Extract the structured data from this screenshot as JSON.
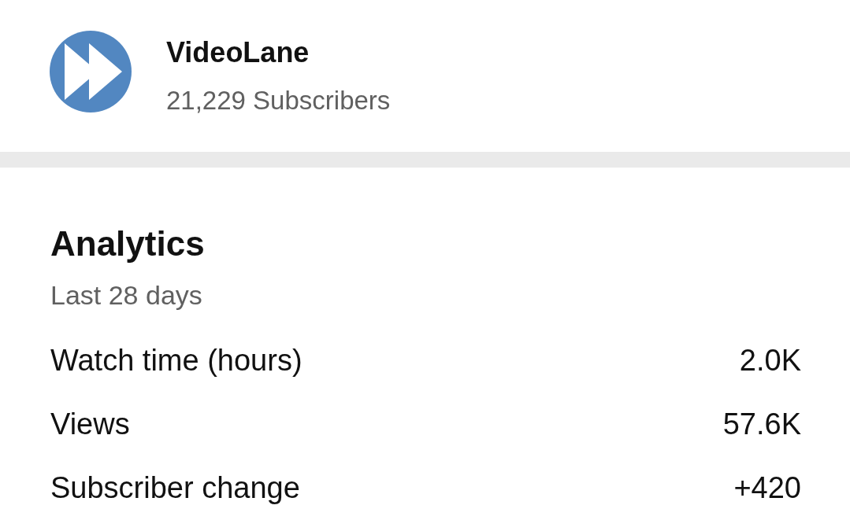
{
  "channel": {
    "name": "VideoLane",
    "subscribers": "21,229 Subscribers"
  },
  "analytics": {
    "title": "Analytics",
    "period": "Last 28 days",
    "metrics": [
      {
        "label": "Watch time (hours)",
        "value": "2.0K"
      },
      {
        "label": "Views",
        "value": "57.6K"
      },
      {
        "label": "Subscriber change",
        "value": "+420"
      }
    ]
  }
}
